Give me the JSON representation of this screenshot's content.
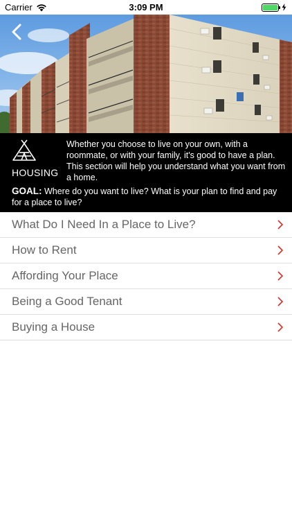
{
  "status_bar": {
    "carrier": "Carrier",
    "time": "3:09 PM"
  },
  "header": {
    "back_icon": "chevron-left-icon"
  },
  "section": {
    "icon": "teepee-tent-icon",
    "title": "HOUSING",
    "intro": "Whether you choose to live on your own, with a roommate, or with your family, it's good to have a plan. This section will help you understand what you want from a home.",
    "goal_label": "GOAL:",
    "goal_text": " Where do you want to live?  What is your plan to find and pay for a place to live?"
  },
  "menu": {
    "items": [
      {
        "label": "What Do I Need In a Place to Live?"
      },
      {
        "label": "How to Rent"
      },
      {
        "label": "Affording Your Place"
      },
      {
        "label": "Being a Good Tenant"
      },
      {
        "label": "Buying a House"
      }
    ]
  },
  "colors": {
    "chevron": "#d0342c",
    "panel_bg": "#000000",
    "label": "#666666",
    "battery": "#4cd964"
  }
}
